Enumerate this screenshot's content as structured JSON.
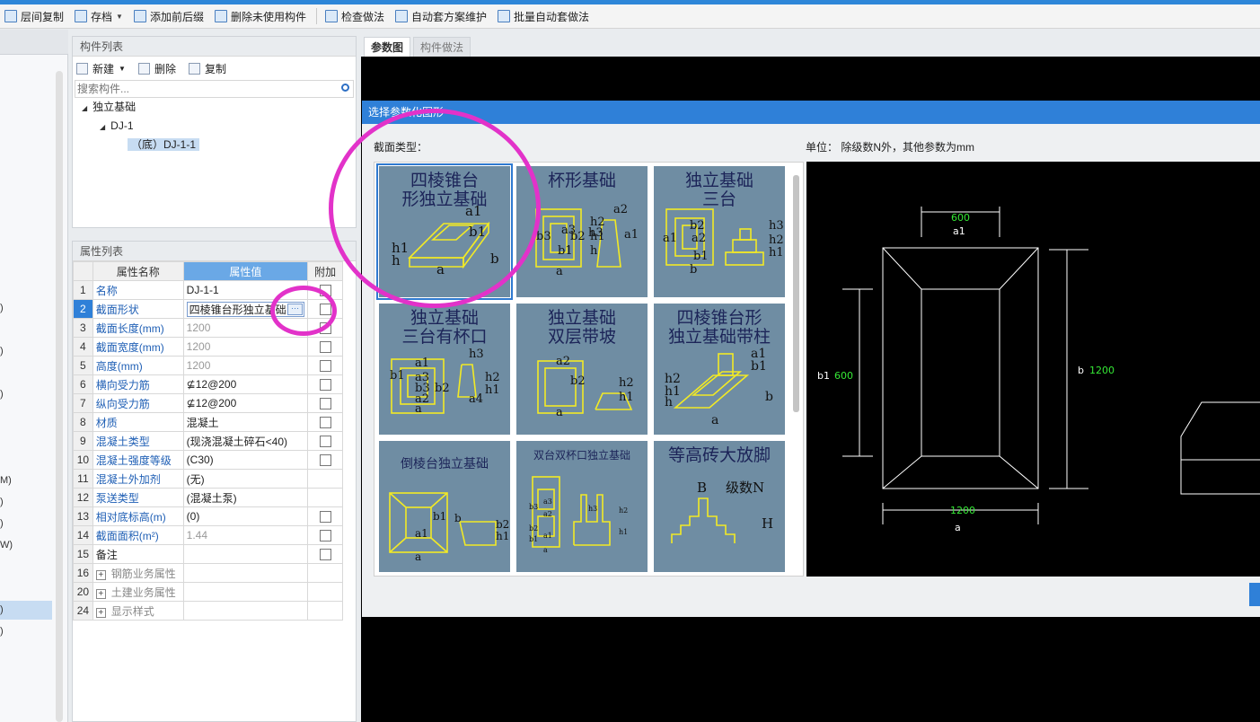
{
  "toolbar": {
    "items": [
      "层间复制",
      "存档",
      "添加前后缀",
      "删除未使用构件",
      "检查做法",
      "自动套方案维护",
      "批量自动套做法"
    ]
  },
  "left_strip": {
    "fragments": [
      ")",
      ")",
      ")",
      "M)",
      ")",
      ")",
      "W)",
      ")",
      ")"
    ]
  },
  "component_list": {
    "title": "构件列表",
    "new_label": "新建",
    "delete_label": "删除",
    "copy_label": "复制",
    "search_placeholder": "搜索构件...",
    "tree": {
      "root": "独立基础",
      "child": "DJ-1",
      "leaf": "（底）DJ-1-1"
    }
  },
  "property_list": {
    "title": "属性列表",
    "headers": {
      "name": "属性名称",
      "value": "属性值",
      "extra": "附加"
    },
    "rows": [
      {
        "n": "1",
        "k": "名称",
        "v": "DJ-1-1"
      },
      {
        "n": "2",
        "k": "截面形状",
        "v": "四棱锥台形独立基础"
      },
      {
        "n": "3",
        "k": "截面长度(mm)",
        "v": "1200"
      },
      {
        "n": "4",
        "k": "截面宽度(mm)",
        "v": "1200"
      },
      {
        "n": "5",
        "k": "高度(mm)",
        "v": "1200"
      },
      {
        "n": "6",
        "k": "横向受力筋",
        "v": "⊈12@200"
      },
      {
        "n": "7",
        "k": "纵向受力筋",
        "v": "⊈12@200"
      },
      {
        "n": "8",
        "k": "材质",
        "v": "混凝土"
      },
      {
        "n": "9",
        "k": "混凝土类型",
        "v": "(现浇混凝土碎石<40)"
      },
      {
        "n": "10",
        "k": "混凝土强度等级",
        "v": "(C30)"
      },
      {
        "n": "11",
        "k": "混凝土外加剂",
        "v": "(无)"
      },
      {
        "n": "12",
        "k": "泵送类型",
        "v": "(混凝土泵)"
      },
      {
        "n": "13",
        "k": "相对底标高(m)",
        "v": "(0)"
      },
      {
        "n": "14",
        "k": "截面面积(m²)",
        "v": "1.44"
      },
      {
        "n": "15",
        "k": "备注",
        "v": ""
      },
      {
        "n": "16",
        "k": "钢筋业务属性",
        "v": ""
      },
      {
        "n": "20",
        "k": "土建业务属性",
        "v": ""
      },
      {
        "n": "24",
        "k": "显示样式",
        "v": ""
      }
    ]
  },
  "view_tabs": [
    "参数图",
    "构件做法"
  ],
  "dialog": {
    "title": "选择参数化图形",
    "section_label": "截面类型：",
    "unit_label": "单位：   除级数N外，其他参数为mm",
    "shapes": [
      "四棱锥台形独立基础",
      "杯形基础",
      "独立基础三台",
      "独立基础三台有杯口",
      "独立基础双层带坡",
      "四棱锥台形独立基础带柱",
      "倒棱台独立基础",
      "双台双杯口独立基础",
      "等高砖大放脚"
    ],
    "shape_titles": [
      [
        "四棱锥台",
        "形独立基础"
      ],
      [
        "杯形基础"
      ],
      [
        "独立基础",
        "三台"
      ],
      [
        "独立基础",
        "三台有杯口"
      ],
      [
        "独立基础",
        "双层带坡"
      ],
      [
        "四棱锥台形",
        "独立基础带柱"
      ],
      [
        "倒棱台独立基础"
      ],
      [
        "双台双杯口独立基础"
      ],
      [
        "等高砖大放脚"
      ]
    ],
    "shape_labels": [
      [
        "a1",
        "b1",
        "h1",
        "h",
        "a",
        "b"
      ],
      [
        "a2",
        "a3",
        "b3",
        "b2",
        "h3",
        "h2",
        "h1",
        "h",
        "a1",
        "b1",
        "a"
      ],
      [
        "b2",
        "a2",
        "a1",
        "b1",
        "h3",
        "h2",
        "h1",
        "b"
      ],
      [
        "a1",
        "b1",
        "a3",
        "b3",
        "b2",
        "a2",
        "a4",
        "h3",
        "h2",
        "h1",
        "a"
      ],
      [
        "a2",
        "b2",
        "h2",
        "h1",
        "a"
      ],
      [
        "a1",
        "b1",
        "h2",
        "h1",
        "h",
        "b",
        "a"
      ],
      [
        "b1",
        "a1",
        "b",
        "b2",
        "h1",
        "a"
      ],
      [
        "a3",
        "a2",
        "a1",
        "b3",
        "b2",
        "b1",
        "h3",
        "h2",
        "h1",
        "a"
      ],
      [
        "B",
        "级数N",
        "H"
      ]
    ],
    "preview": {
      "a1": "600",
      "b1": "600",
      "a": "1200",
      "b": "1200",
      "a1_label": "a1",
      "b1_label": "b1",
      "a_label": "a",
      "b_label": "b"
    }
  },
  "colors": {
    "accent": "#2f80d8",
    "annotation": "#e232c9",
    "tile_bg": "#6f8da3",
    "shape_line": "#f2ea25",
    "dim_green": "#35e835"
  }
}
